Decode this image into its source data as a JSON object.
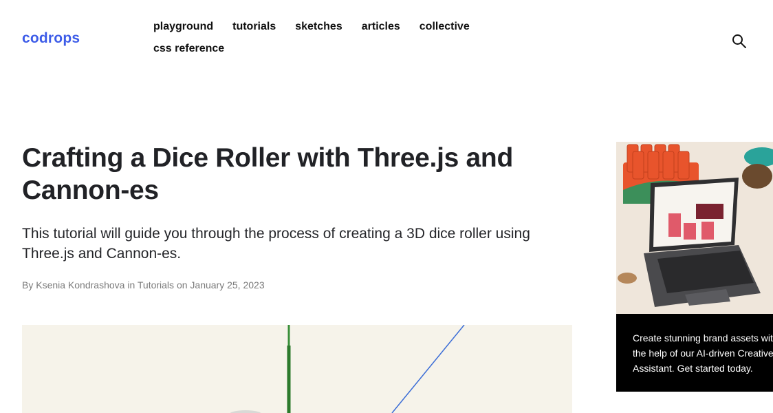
{
  "header": {
    "logo": "codrops",
    "nav": [
      "playground",
      "tutorials",
      "sketches",
      "articles",
      "collective",
      "css reference"
    ]
  },
  "article": {
    "title": "Crafting a Dice Roller with Three.js and Cannon-es",
    "subtitle": "This tutorial will guide you through the process of creating a 3D dice roller using Three.js and Cannon-es.",
    "byline": {
      "by": "By",
      "author": "Ksenia Kondrashova",
      "in": "in",
      "category": "Tutorials",
      "on": "on",
      "date": "January 25, 2023"
    }
  },
  "ad": {
    "text": "Create stunning brand assets with the help of our AI-driven Creative Assistant. Get started today."
  },
  "colors": {
    "brand": "#3d5ce8",
    "hero_background": "#f6f3ea",
    "ad_background": "#000000"
  },
  "icons": {
    "search": "search-icon"
  }
}
